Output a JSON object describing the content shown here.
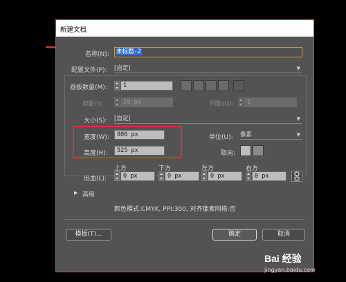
{
  "dialog": {
    "title": "新建文档"
  },
  "name": {
    "label": "名称(N):",
    "value": "未标题-2"
  },
  "profile": {
    "label": "配置文件(P):",
    "value": "[自定]"
  },
  "artboards": {
    "count_label": "画板数量(M):",
    "count_value": "1",
    "spacing_label": "间距(I):",
    "spacing_value": "20 px",
    "columns_label": "列数(O):",
    "columns_value": "1"
  },
  "size": {
    "label": "大小(S):",
    "value": "[自定]"
  },
  "width": {
    "label": "宽度(W):",
    "value": "800 px"
  },
  "height": {
    "label": "高度(H):",
    "value": "525 px"
  },
  "units": {
    "label": "单位(U):",
    "value": "像素"
  },
  "orientation": {
    "label": "取向:"
  },
  "bleed": {
    "label": "出血(L):",
    "top_label": "上方",
    "bottom_label": "下方",
    "left_label": "左方",
    "right_label": "右方",
    "top": "0 px",
    "bottom": "0 px",
    "left": "0 px",
    "right": "0 px"
  },
  "advanced": {
    "label": "高级"
  },
  "info": {
    "text": "颜色模式:CMYK, PPI:300, 对齐像素网格:否"
  },
  "buttons": {
    "template": "模板(T)...",
    "ok": "确定",
    "cancel": "取消"
  },
  "watermark": {
    "text": "Bai 经验",
    "url": "jingyan.baidu.com"
  },
  "colors": {
    "annotation_red": "#e03030",
    "dialog_bg": "#535353"
  }
}
